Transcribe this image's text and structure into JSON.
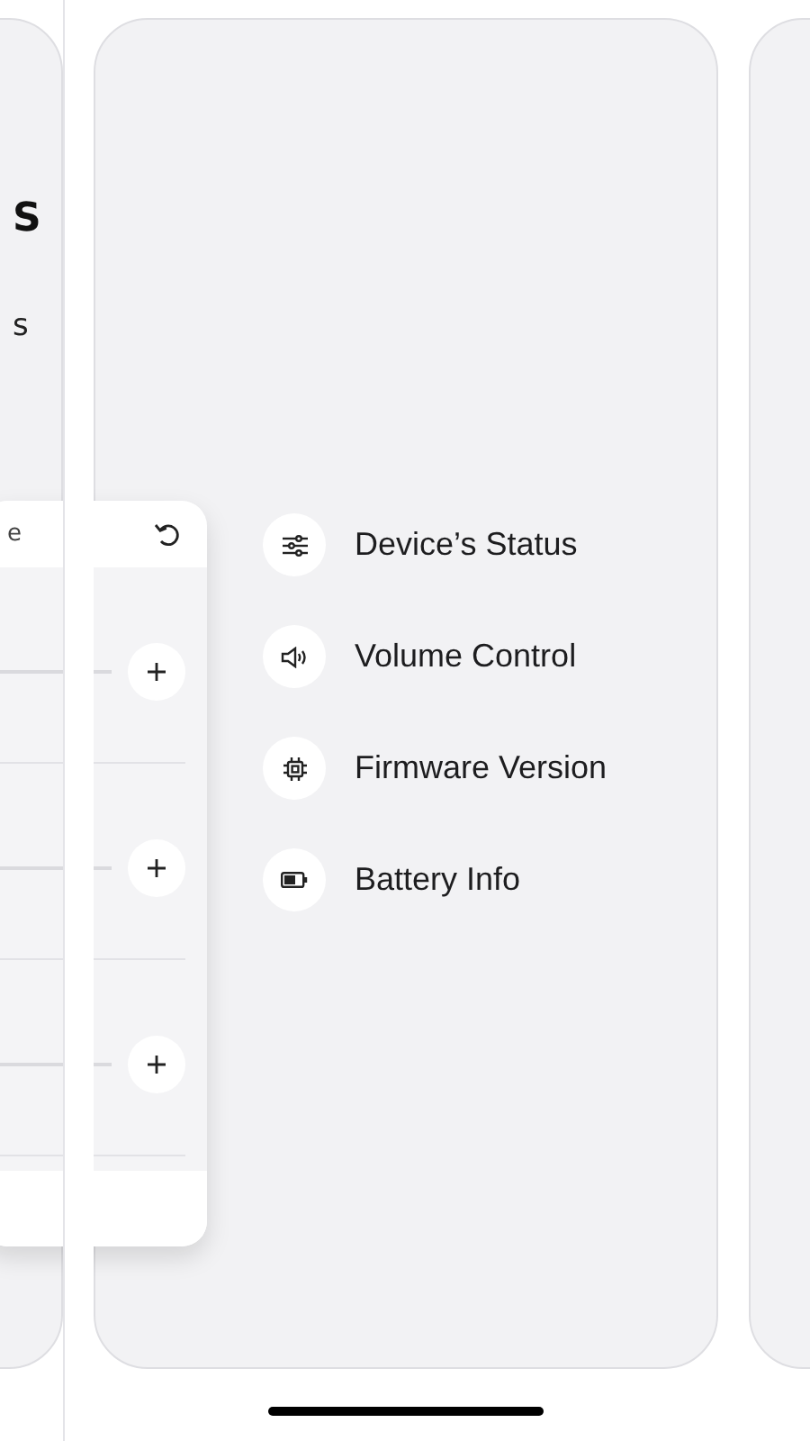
{
  "left_card": {
    "title": "S",
    "subtitle": "s"
  },
  "panel": {
    "header": "e",
    "rows": [
      {
        "kind": "stepper"
      },
      {
        "kind": "stepper"
      },
      {
        "kind": "stepper"
      }
    ]
  },
  "menu": [
    {
      "label": "Device’s Status",
      "kind": "sliders"
    },
    {
      "label": "Volume Control",
      "kind": "speaker"
    },
    {
      "label": "Firmware Version",
      "kind": "chip"
    },
    {
      "label": "Battery Info",
      "kind": "battery"
    }
  ]
}
